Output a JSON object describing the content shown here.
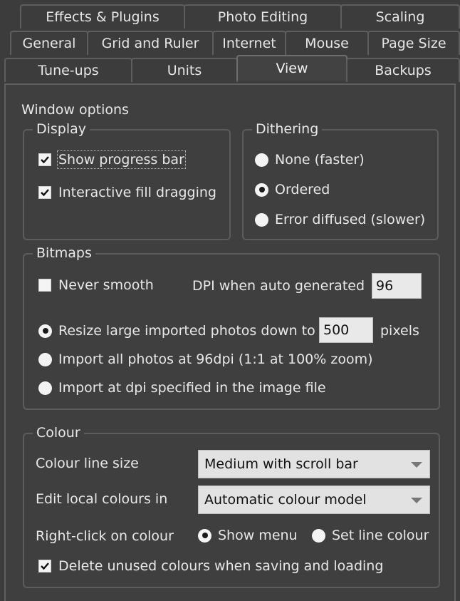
{
  "tabs": {
    "row1": [
      "Effects & Plugins",
      "Photo Editing",
      "Scaling"
    ],
    "row2": [
      "General",
      "Grid and Ruler",
      "Internet",
      "Mouse",
      "Page Size"
    ],
    "row3": [
      "Tune-ups",
      "Units",
      "View",
      "Backups"
    ]
  },
  "active_tab": "View",
  "section_title": "Window options",
  "display": {
    "title": "Display",
    "show_progress_bar": {
      "label": "Show progress bar",
      "checked": true
    },
    "interactive_fill_dragging": {
      "label": "Interactive fill dragging",
      "checked": true
    }
  },
  "dithering": {
    "title": "Dithering",
    "options": [
      {
        "label": "None (faster)",
        "checked": false
      },
      {
        "label": "Ordered",
        "checked": true
      },
      {
        "label": "Error diffused (slower)",
        "checked": false
      }
    ]
  },
  "bitmaps": {
    "title": "Bitmaps",
    "never_smooth": {
      "label": "Never smooth",
      "checked": false
    },
    "dpi_label": "DPI when auto generated",
    "dpi_value": "96",
    "resize_label": "Resize large imported photos down to",
    "resize_value": "500",
    "resize_unit": "pixels",
    "import_96_label": "Import all photos at 96dpi (1:1 at 100% zoom)",
    "import_file_label": "Import at dpi specified in the image file",
    "selected_option": "resize"
  },
  "colour": {
    "title": "Colour",
    "line_size_label": "Colour line size",
    "line_size_value": "Medium with scroll bar",
    "edit_local_label": "Edit local colours in",
    "edit_local_value": "Automatic colour model",
    "right_click_label": "Right-click on colour",
    "show_menu_label": "Show menu",
    "set_line_label": "Set line colour",
    "right_click_selected": "Show menu",
    "delete_unused_label": "Delete unused colours when saving and loading",
    "delete_unused_checked": true
  }
}
